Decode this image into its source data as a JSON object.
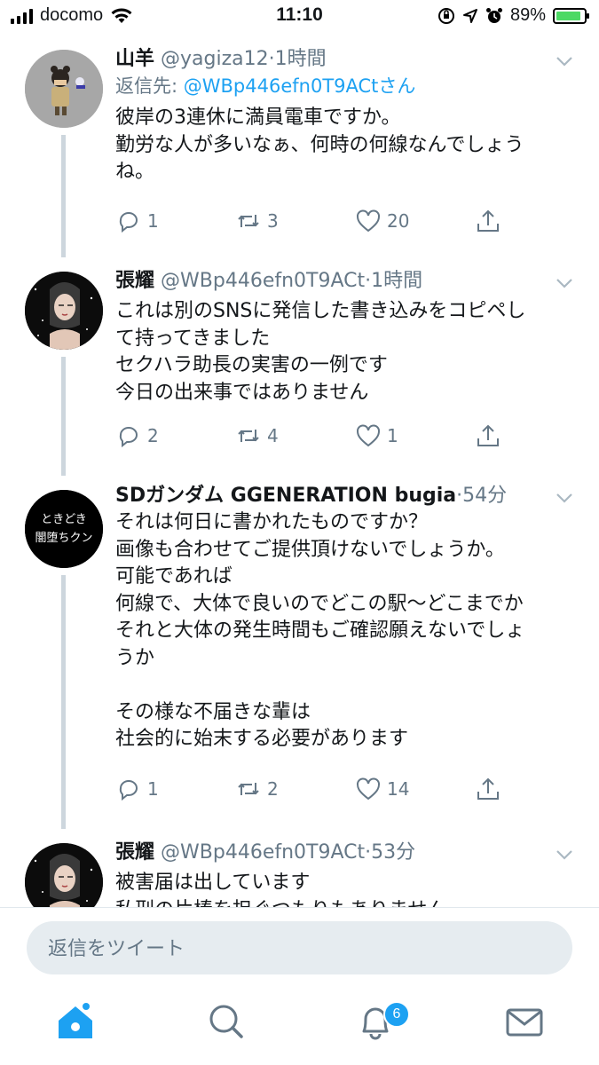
{
  "status_bar": {
    "carrier": "docomo",
    "time": "11:10",
    "battery_percent": "89%"
  },
  "tweets": [
    {
      "name": "山羊",
      "handle": "@yagiza12",
      "time": "1時間",
      "reply_label": "返信先:",
      "reply_mention": "@WBp446efn0T9ACtさん",
      "lines": [
        "彼岸の3連休に満員電車ですか。",
        "勤労な人が多いなぁ、何時の何線なんでしょう",
        "ね。"
      ],
      "replies": "1",
      "retweets": "3",
      "likes": "20"
    },
    {
      "name": "張耀",
      "handle": "@WBp446efn0T9ACt",
      "time": "1時間",
      "lines": [
        "これは別のSNSに発信した書き込みをコピペし",
        "て持ってきました",
        "セクハラ助長の実害の一例です",
        "今日の出来事ではありません"
      ],
      "replies": "2",
      "retweets": "4",
      "likes": "1"
    },
    {
      "name": "SDガンダム GGENERATION bugia",
      "handle": "",
      "time": "54分",
      "avatar_text": [
        "ときどき",
        "闇堕ちクン"
      ],
      "lines": [
        "それは何日に書かれたものですか？",
        "画像も合わせてご提供頂けないでしょうか。",
        "可能であれば",
        "何線で、大体で良いのでどこの駅〜どこまでか",
        "それと大体の発生時間もご確認願えないでしょ",
        "うか",
        "",
        "その様な不届きな輩は",
        "社会的に始末する必要があります"
      ],
      "replies": "1",
      "retweets": "2",
      "likes": "14"
    },
    {
      "name": "張耀",
      "handle": "@WBp446efn0T9ACt",
      "time": "53分",
      "lines": [
        "被害届は出しています",
        "私刑の片棒を担ぐつもりもありません"
      ]
    }
  ],
  "composer": {
    "placeholder": "返信をツイート"
  },
  "tabbar": {
    "notification_count": "6"
  },
  "colors": {
    "accent": "#1da1f2",
    "secondary_text": "#657786",
    "thread_line": "#cdd6dd"
  }
}
